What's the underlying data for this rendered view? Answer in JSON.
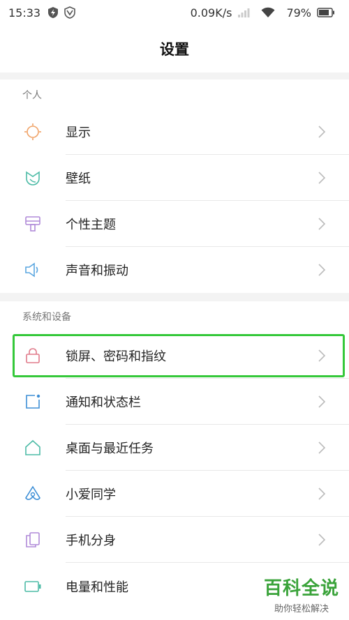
{
  "status_bar": {
    "time": "15:33",
    "net_speed": "0.09K/s",
    "battery": "79%"
  },
  "header": {
    "title": "设置"
  },
  "sections": [
    {
      "title": "个人",
      "items": [
        {
          "label": "显示",
          "icon": "brightness-icon"
        },
        {
          "label": "壁纸",
          "icon": "tulip-icon"
        },
        {
          "label": "个性主题",
          "icon": "paint-roller-icon"
        },
        {
          "label": "声音和振动",
          "icon": "speaker-icon"
        }
      ]
    },
    {
      "title": "系统和设备",
      "items": [
        {
          "label": "锁屏、密码和指纹",
          "icon": "lock-icon"
        },
        {
          "label": "通知和状态栏",
          "icon": "notification-icon"
        },
        {
          "label": "桌面与最近任务",
          "icon": "home-icon"
        },
        {
          "label": "小爱同学",
          "icon": "assistant-icon"
        },
        {
          "label": "手机分身",
          "icon": "dual-phone-icon"
        },
        {
          "label": "电量和性能",
          "icon": "battery-icon"
        }
      ]
    }
  ],
  "watermark": {
    "main": "百科全说",
    "sub": "助你轻松解决"
  },
  "colors": {
    "highlight": "#35c83a",
    "watermark": "#3aa33a"
  }
}
